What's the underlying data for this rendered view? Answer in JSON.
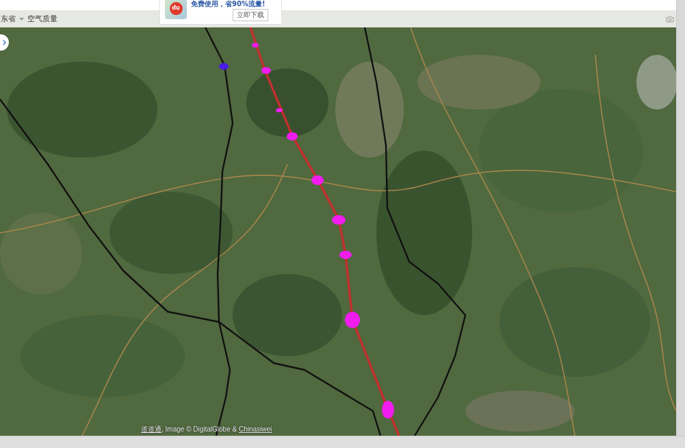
{
  "toolbar": {
    "region": "东省",
    "air_quality": "空气质量"
  },
  "ad_popup": {
    "logo_text": "du",
    "message": "免费使用，省90%流量!",
    "download_button": "立即下载"
  },
  "map": {
    "attribution": {
      "provider_link": "道道通",
      "text": ", Image © DigitalGlobe & ",
      "source_link": "Chinasiwei"
    }
  }
}
